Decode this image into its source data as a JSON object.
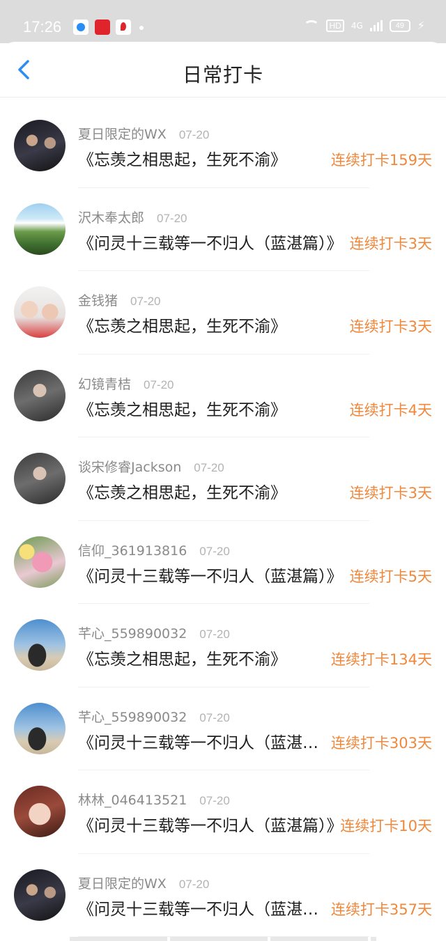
{
  "status_bar": {
    "time": "17:26",
    "network": "4G",
    "hd": "HD",
    "battery": "49"
  },
  "header": {
    "title": "日常打卡",
    "back_icon": "chevron-left-icon",
    "accent_color": "#2a8df5"
  },
  "colors": {
    "streak": "#f0883c",
    "username": "#8a8a8a",
    "date": "#b3b3b3"
  },
  "items": [
    {
      "username": "夏日限定的WX",
      "date": "07-20",
      "title": "《忘羡之相思起，生死不渝》",
      "streak": "连续打卡159天",
      "avatar": "dark-portrait"
    },
    {
      "username": "沢木奉太郎",
      "date": "07-20",
      "title": "《问灵十三载等一不归人（蓝湛篇）》",
      "streak": "连续打卡3天",
      "avatar": "mountain-landscape"
    },
    {
      "username": "金钱猪",
      "date": "07-20",
      "title": "《忘羡之相思起，生死不渝》",
      "streak": "连续打卡3天",
      "avatar": "two-people-selfie"
    },
    {
      "username": "幻镜青桔",
      "date": "07-20",
      "title": "《忘羡之相思起，生死不渝》",
      "streak": "连续打卡4天",
      "avatar": "portrait"
    },
    {
      "username": "谈宋修睿Jackson",
      "date": "07-20",
      "title": "《忘羡之相思起，生死不渝》",
      "streak": "连续打卡3天",
      "avatar": "portrait"
    },
    {
      "username": "信仰_361913816",
      "date": "07-20",
      "title": "《问灵十三载等一不归人（蓝湛篇）》",
      "streak": "连续打卡5天",
      "avatar": "flowers"
    },
    {
      "username": "芊心_559890032",
      "date": "07-20",
      "title": "《忘羡之相思起，生死不渝》",
      "streak": "连续打卡134天",
      "avatar": "beach-portrait"
    },
    {
      "username": "芊心_559890032",
      "date": "07-20",
      "title": "《问灵十三载等一不归人（蓝湛篇）》",
      "streak": "连续打卡303天",
      "avatar": "beach-portrait"
    },
    {
      "username": "林林_046413521",
      "date": "07-20",
      "title": "《问灵十三载等一不归人（蓝湛篇）》",
      "streak": "连续打卡10天",
      "avatar": "face-portrait"
    },
    {
      "username": "夏日限定的WX",
      "date": "07-20",
      "title": "《问灵十三载等一不归人（蓝湛篇）》",
      "streak": "连续打卡357天",
      "avatar": "dark-portrait"
    }
  ]
}
